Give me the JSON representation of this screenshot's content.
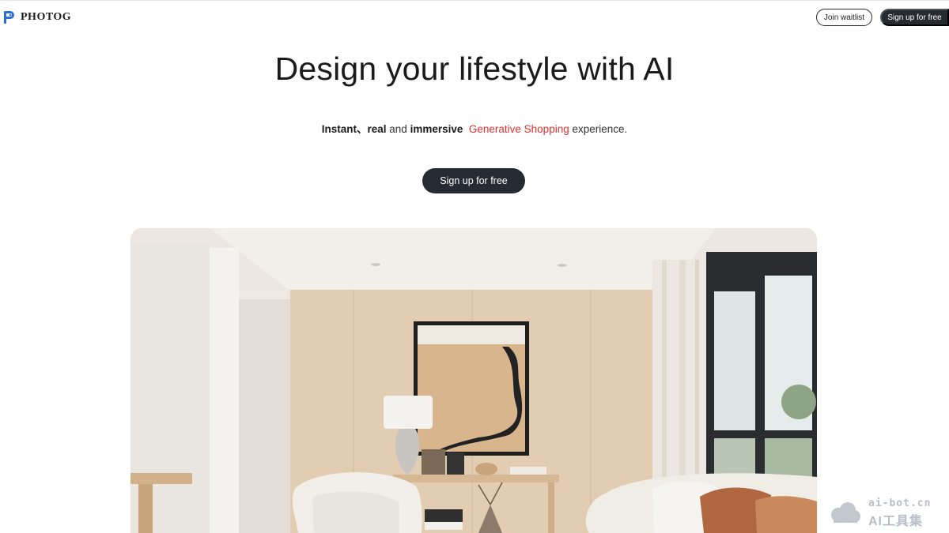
{
  "header": {
    "brand": "PHOTOG",
    "join_waitlist_label": "Join waitlist",
    "signup_label": "Sign up for free"
  },
  "hero": {
    "title": "Design your lifestyle with AI",
    "subtitle": {
      "part1": "Instant",
      "sep": "、",
      "part2": "real",
      "and": " and ",
      "part3": "immersive",
      "accent": "Generative Shopping",
      "tail": " experience."
    },
    "cta_label": "Sign up for free"
  },
  "watermark": {
    "line1": "ai-bot.cn",
    "line2": "AI工具集"
  },
  "colors": {
    "accent": "#e0312e",
    "dark_button": "#262b33",
    "logo_blue": "#2b6fd6"
  }
}
